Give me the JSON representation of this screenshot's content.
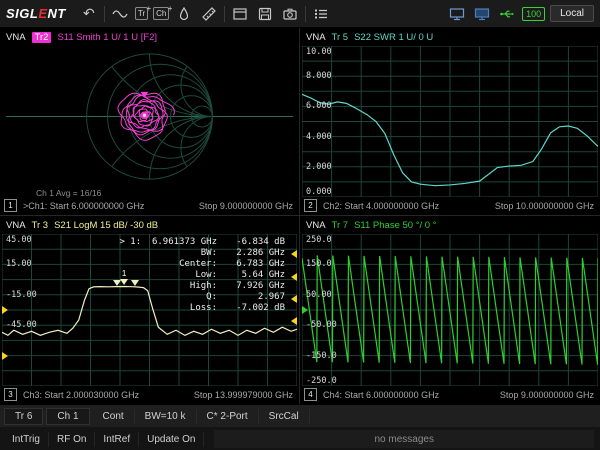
{
  "toolbar": {
    "logo_prefix": "SIGL",
    "logo_accent": "E",
    "logo_suffix": "NT",
    "icons": {
      "undo": "↶",
      "tr": "Tr",
      "ch": "Ch",
      "plus": "+"
    },
    "battery": "100",
    "local_label": "Local"
  },
  "panels": [
    {
      "vna": "VNA",
      "trace": "Tr2",
      "title": "S11 Smith 1 U/ 1 U [F2]",
      "avg": "Ch 1 Avg = 16/16",
      "number": "1",
      "start": ">Ch1: Start 6.000000000 GHz",
      "stop": "Stop 9.000000000 GHz",
      "trace_color": "#f23fd3"
    },
    {
      "vna": "VNA",
      "trace": "Tr 5",
      "title": "S22 SWR 1 U/ 0 U",
      "number": "2",
      "start": "Ch2: Start 4.000000000 GHz",
      "stop": "Stop 10.000000000 GHz",
      "trace_color": "#5fd7c8"
    },
    {
      "vna": "VNA",
      "trace": "Tr 3",
      "title": "S21 LogM 15 dB/ -30 dB",
      "number": "3",
      "start": "Ch3: Start 2.000030000 GHz",
      "stop": "Stop 13.999979000 GHz",
      "trace_color": "#efefc0"
    },
    {
      "vna": "VNA",
      "trace": "Tr 7",
      "title": "S11 Phase 50 °/ 0 °",
      "number": "4",
      "start": "Ch4: Start 6.000000000 GHz",
      "stop": "Stop 9.000000000 GHz",
      "trace_color": "#2fcf2f"
    }
  ],
  "marker_readout": {
    "rows": [
      {
        "label": "> 1:  6.961373 GHz",
        "value": "-6.834 dB"
      },
      {
        "label": "BW:",
        "value": "2.286 GHz"
      },
      {
        "label": "Center:",
        "value": "6.783 GHz"
      },
      {
        "label": "Low:",
        "value": "5.64 GHz"
      },
      {
        "label": "High:",
        "value": "7.926 GHz"
      },
      {
        "label": "Q:",
        "value": "2.967"
      },
      {
        "label": "Loss:",
        "value": "-7.002 dB"
      }
    ]
  },
  "status_row1": [
    "Tr 6",
    "Ch 1",
    "Cont",
    "BW=10 k",
    "C* 2-Port",
    "SrcCal"
  ],
  "status_row2": [
    "IntTrig",
    "RF On",
    "IntRef",
    "Update On"
  ],
  "message": "no messages",
  "chart_data": [
    {
      "id": "smith",
      "type": "smith",
      "channel": "Ch1",
      "measurement": "S11",
      "format": "Smith",
      "scale": "1 U/",
      "reference": "1 U",
      "x_range_ghz": [
        6,
        9
      ],
      "trace_color": "#f23fd3",
      "grid_color": "#1d4a3c",
      "axis_color": "#2a6e54",
      "trace_loops": {
        "turns": 9,
        "r_start": 0.4,
        "r_end": 0.03,
        "center": [
          -0.08,
          0.02
        ],
        "wobble": 0.16
      },
      "marker": {
        "u": -0.08,
        "v": 0.3
      }
    },
    {
      "id": "swr",
      "type": "line",
      "channel": "Ch2",
      "measurement": "S22",
      "format": "SWR",
      "x_range_ghz": [
        4,
        10
      ],
      "ylim": [
        0,
        10
      ],
      "grid": true,
      "trace_color": "#5fd7c8",
      "grid_color": "#1b4639",
      "yticks": [
        {
          "label": "10.00",
          "frac": 0
        },
        {
          "label": "8.000",
          "frac": 0.2
        },
        {
          "label": "6.000",
          "frac": 0.4
        },
        {
          "label": "4.000",
          "frac": 0.6
        },
        {
          "label": "2.000",
          "frac": 0.8
        },
        {
          "label": "0.000",
          "frac": 1
        }
      ],
      "points": [
        [
          0,
          6.8
        ],
        [
          0.03,
          6.55
        ],
        [
          0.06,
          6.25
        ],
        [
          0.09,
          6.15
        ],
        [
          0.12,
          6.3
        ],
        [
          0.15,
          6.2
        ],
        [
          0.18,
          5.9
        ],
        [
          0.22,
          5.45
        ],
        [
          0.25,
          5.0
        ],
        [
          0.28,
          4.2
        ],
        [
          0.31,
          2.8
        ],
        [
          0.34,
          1.6
        ],
        [
          0.37,
          1.0
        ],
        [
          0.4,
          0.85
        ],
        [
          0.45,
          0.75
        ],
        [
          0.5,
          0.8
        ],
        [
          0.55,
          0.9
        ],
        [
          0.6,
          1.05
        ],
        [
          0.63,
          1.5
        ],
        [
          0.66,
          1.95
        ],
        [
          0.7,
          2.05
        ],
        [
          0.74,
          2.1
        ],
        [
          0.78,
          2.35
        ],
        [
          0.81,
          3.2
        ],
        [
          0.84,
          4.25
        ],
        [
          0.87,
          4.65
        ],
        [
          0.9,
          4.7
        ],
        [
          0.93,
          4.55
        ],
        [
          0.96,
          4.1
        ],
        [
          1,
          3.35
        ]
      ]
    },
    {
      "id": "logmag",
      "type": "line",
      "channel": "Ch3",
      "measurement": "S21",
      "format": "LogM",
      "x_range_ghz": [
        2.00003,
        13.999979
      ],
      "ylim": [
        -105,
        45
      ],
      "grid": true,
      "trace_color": "#efefc0",
      "grid_color": "#1b4639",
      "yticks": [
        {
          "label": "45.00",
          "frac": 0
        },
        {
          "label": "15.00",
          "frac": 0.2
        },
        {
          "label": "-15.00",
          "frac": 0.4
        },
        {
          "label": "-45.00",
          "frac": 0.6
        }
      ],
      "points": [
        [
          0,
          -52
        ],
        [
          0.02,
          -55
        ],
        [
          0.04,
          -50
        ],
        [
          0.07,
          -54
        ],
        [
          0.1,
          -51
        ],
        [
          0.13,
          -55
        ],
        [
          0.16,
          -52
        ],
        [
          0.19,
          -50
        ],
        [
          0.22,
          -53
        ],
        [
          0.24,
          -48
        ],
        [
          0.26,
          -40
        ],
        [
          0.28,
          -20
        ],
        [
          0.295,
          -9
        ],
        [
          0.31,
          -7.2
        ],
        [
          0.33,
          -6.9
        ],
        [
          0.36,
          -7.1
        ],
        [
          0.39,
          -6.9
        ],
        [
          0.413,
          -6.8
        ],
        [
          0.44,
          -7
        ],
        [
          0.46,
          -7.3
        ],
        [
          0.48,
          -8
        ],
        [
          0.494,
          -11
        ],
        [
          0.51,
          -28
        ],
        [
          0.53,
          -47
        ],
        [
          0.56,
          -54
        ],
        [
          0.59,
          -50
        ],
        [
          0.62,
          -55
        ],
        [
          0.65,
          -51
        ],
        [
          0.68,
          -54
        ],
        [
          0.71,
          -49
        ],
        [
          0.74,
          -53
        ],
        [
          0.77,
          -50
        ],
        [
          0.8,
          -55
        ],
        [
          0.83,
          -50
        ],
        [
          0.86,
          -53
        ],
        [
          0.89,
          -48
        ],
        [
          0.92,
          -52
        ],
        [
          0.95,
          -47
        ],
        [
          0.98,
          -51
        ],
        [
          1,
          -49
        ]
      ],
      "markers": [
        {
          "xfrac": 0.39,
          "yval": -6.9,
          "label": ""
        },
        {
          "xfrac": 0.413,
          "yval": -6.8,
          "label": "1"
        },
        {
          "xfrac": 0.45,
          "yval": -7,
          "label": ""
        }
      ],
      "left_arrows": [
        {
          "frac": 0.5,
          "color": "#f5d31f"
        },
        {
          "frac": 0.8,
          "color": "#f5d31f"
        }
      ],
      "right_arrows": [
        {
          "frac": 0.13,
          "color": "#f5d31f"
        },
        {
          "frac": 0.28,
          "color": "#f5d31f"
        },
        {
          "frac": 0.43,
          "color": "#f5d31f"
        },
        {
          "frac": 0.57,
          "color": "#f5d31f"
        }
      ]
    },
    {
      "id": "phase",
      "type": "line",
      "channel": "Ch4",
      "measurement": "S11",
      "format": "Phase",
      "x_range_ghz": [
        6,
        9
      ],
      "ylim": [
        -250,
        250
      ],
      "grid": true,
      "trace_color": "#2fcf2f",
      "grid_color": "#1b4639",
      "yticks": [
        {
          "label": "250.0",
          "frac": 0
        },
        {
          "label": "150.0",
          "frac": 0.2
        },
        {
          "label": "50.00",
          "frac": 0.4
        },
        {
          "label": "-50.00",
          "frac": 0.6
        },
        {
          "label": "-150.0",
          "frac": 0.8
        },
        {
          "label": "-250.0",
          "frac": 1
        }
      ],
      "generator": {
        "kind": "wrapped_phase",
        "cycles": 19,
        "phase_start": 171,
        "samples": 760
      },
      "left_arrows": [
        {
          "frac": 0.5,
          "color": "#2fcf2f"
        }
      ]
    }
  ]
}
